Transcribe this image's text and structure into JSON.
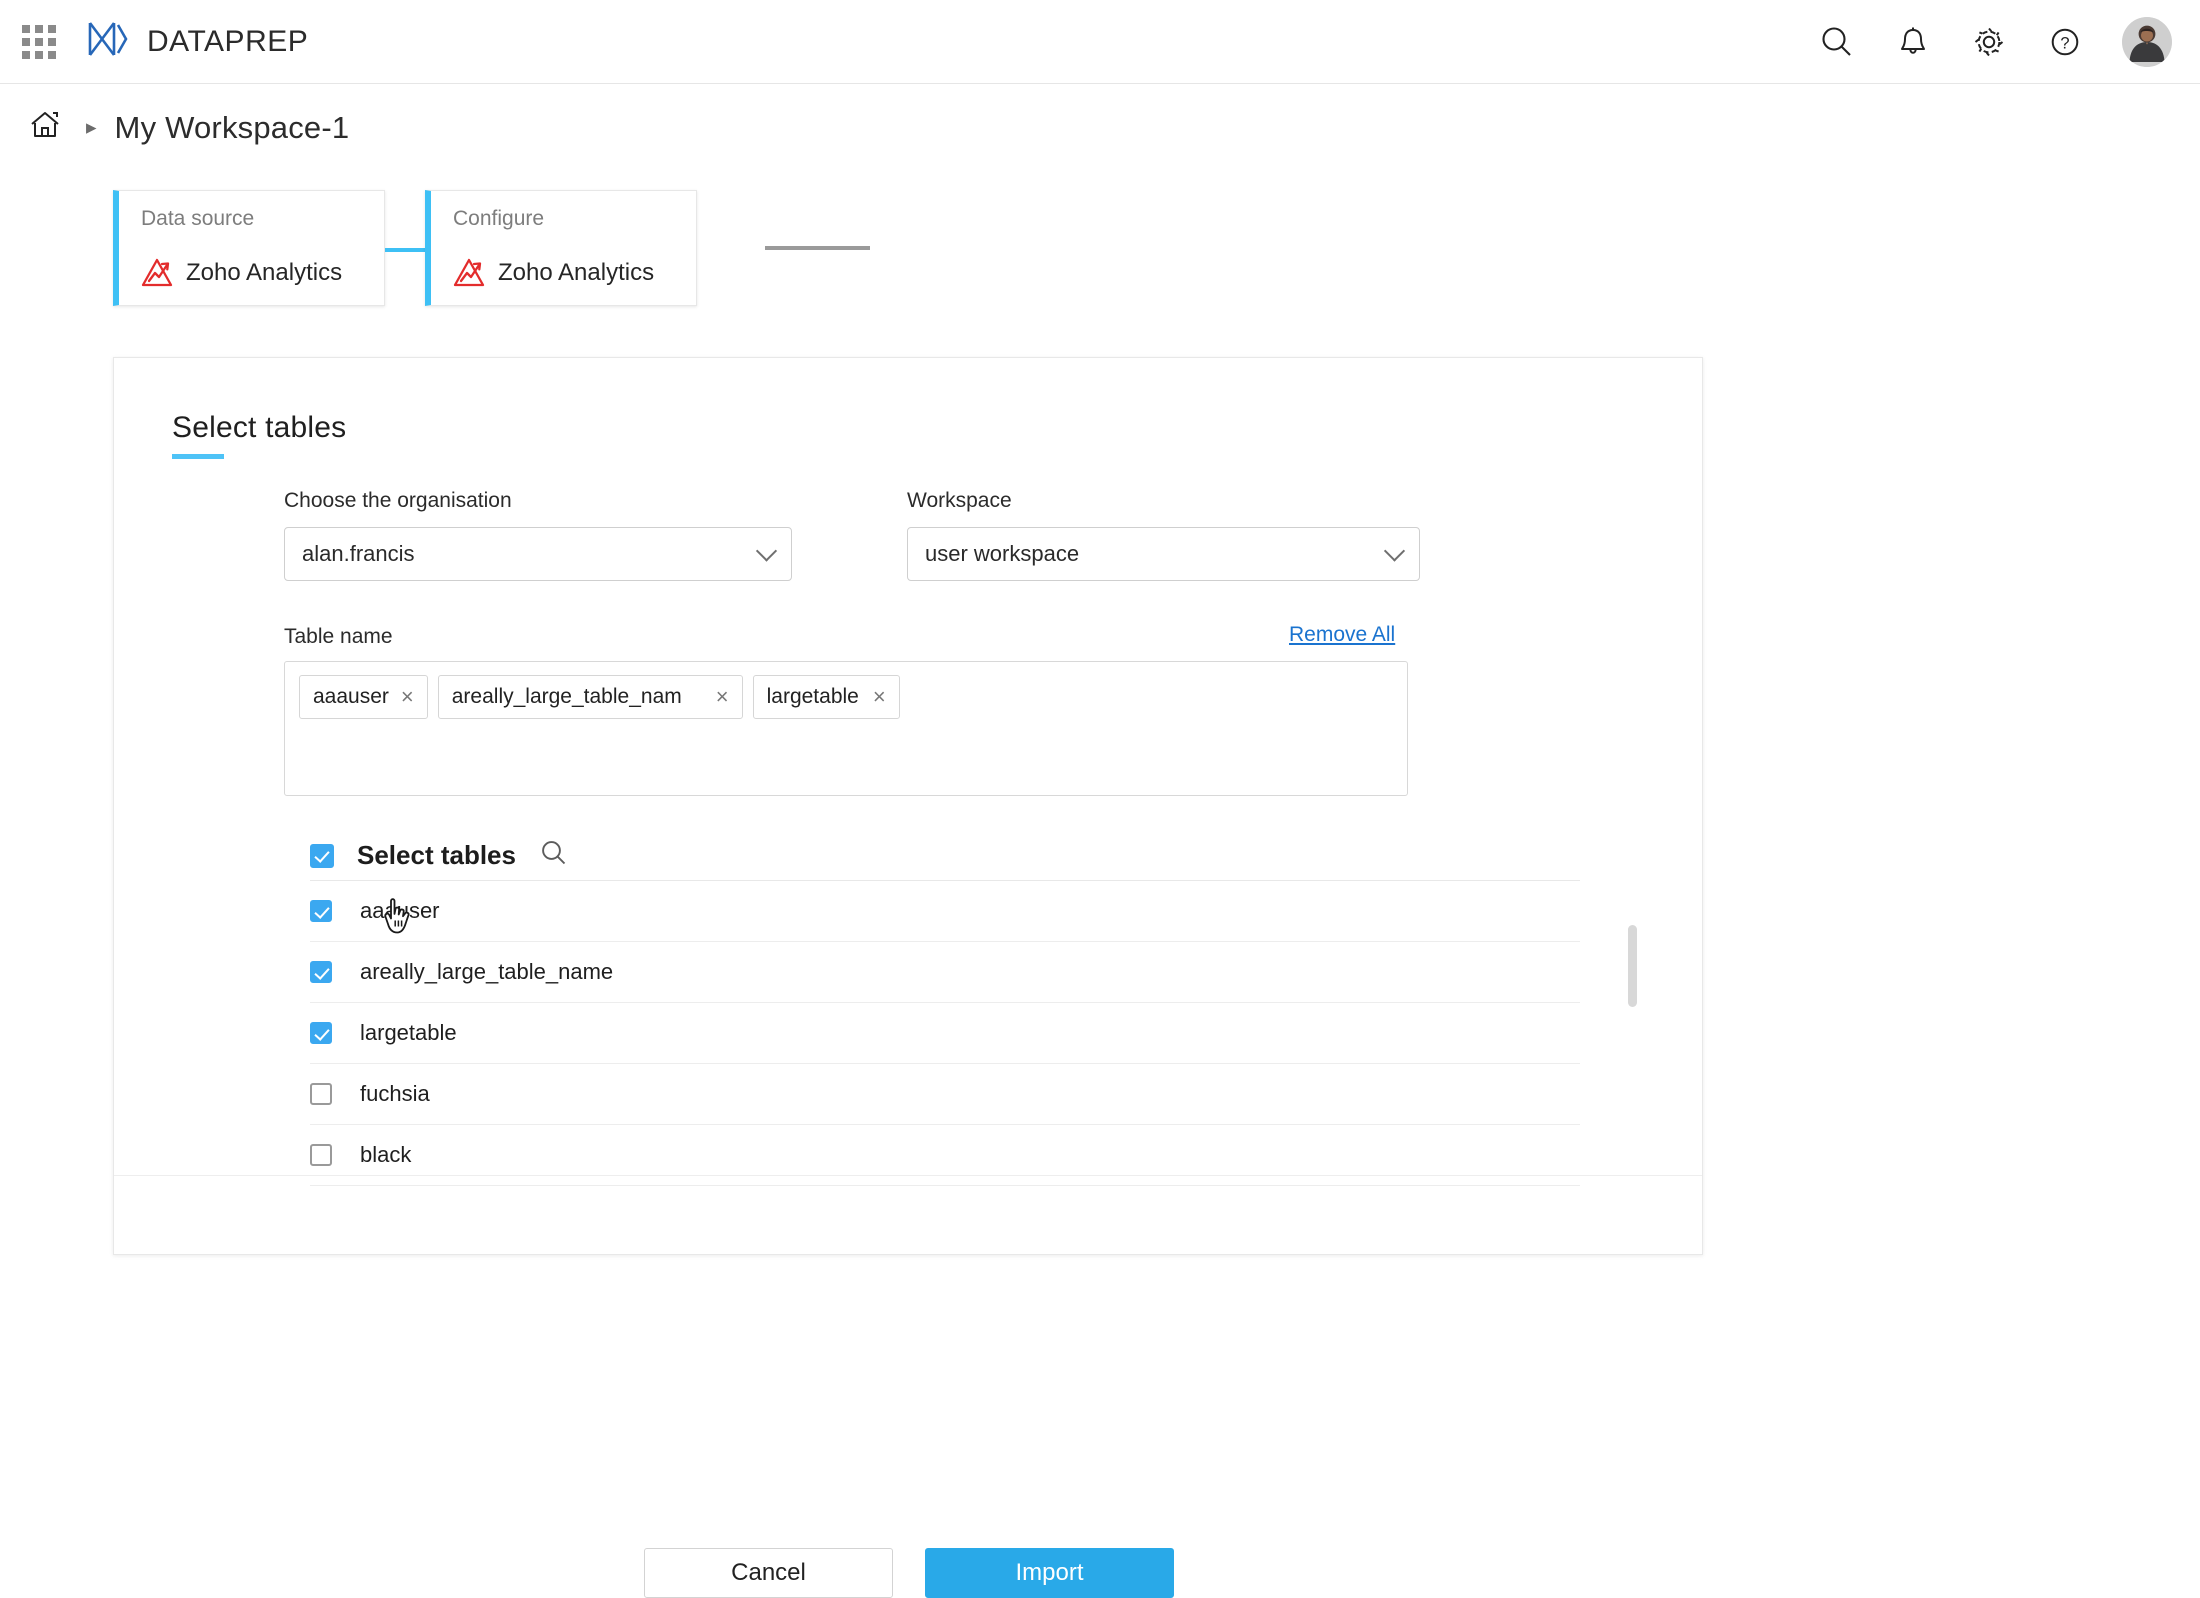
{
  "app": {
    "name": "DATAPREP",
    "logo_icon": "dataprep-logo-icon",
    "grid_icon": "apps-grid-icon"
  },
  "topbar": {
    "icons": [
      {
        "name": "search-icon",
        "label": "Search"
      },
      {
        "name": "bell-icon",
        "label": "Notifications"
      },
      {
        "name": "gear-icon",
        "label": "Settings"
      },
      {
        "name": "help-icon",
        "label": "Help"
      }
    ],
    "avatar": {
      "name": "avatar",
      "label": "User profile"
    }
  },
  "breadcrumb": {
    "home_icon": "home-icon",
    "separator": "▸",
    "title": "My Workspace-1"
  },
  "steps": [
    {
      "label": "Data source",
      "value": "Zoho Analytics",
      "icon": "zoho-analytics-icon"
    },
    {
      "label": "Configure",
      "value": "Zoho Analytics",
      "icon": "zoho-analytics-icon"
    }
  ],
  "card": {
    "title": "Select tables",
    "organisation": {
      "label": "Choose the organisation",
      "value": "alan.francis",
      "options": [
        "alan.francis"
      ]
    },
    "workspace": {
      "label": "Workspace",
      "value": "user workspace",
      "options": [
        "user workspace"
      ]
    },
    "table_name": {
      "label": "Table name",
      "remove_all": "Remove All",
      "tags": [
        {
          "text": "aaauser",
          "remove": "×"
        },
        {
          "text": "areally_large_table_nam",
          "remove": "×"
        },
        {
          "text": "largetable",
          "remove": "×"
        }
      ]
    },
    "list": {
      "header_label": "Select tables",
      "header_checked": true,
      "search_icon": "search-icon",
      "items": [
        {
          "label": "aaauser",
          "checked": true
        },
        {
          "label": "areally_large_table_name",
          "checked": true
        },
        {
          "label": "largetable",
          "checked": true
        },
        {
          "label": "fuchsia",
          "checked": false
        },
        {
          "label": "black",
          "checked": false
        }
      ]
    },
    "buttons": {
      "cancel": "Cancel",
      "import": "Import"
    }
  },
  "colors": {
    "accent_blue": "#3ec0f5",
    "primary_button": "#29a9e8",
    "link_blue": "#1a73cf",
    "logo_red": "#e32c2c",
    "logo_blue": "#2767b8"
  },
  "cursor": {
    "name": "hand-cursor",
    "type": "pointer"
  }
}
